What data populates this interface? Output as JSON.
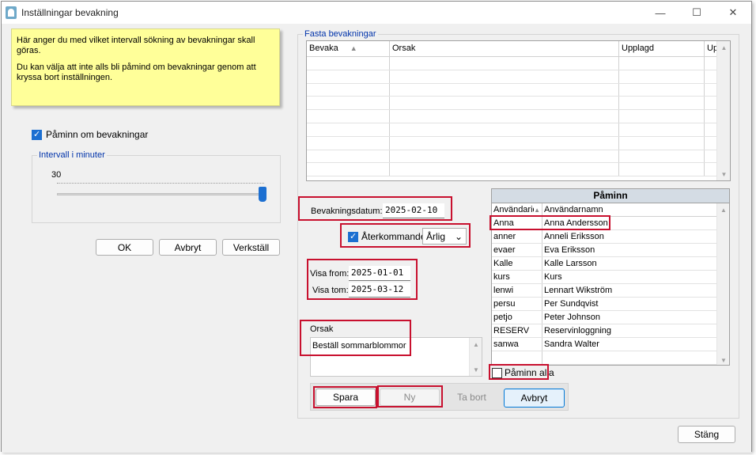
{
  "window": {
    "title": "Inställningar bevakning"
  },
  "title_controls": {
    "minimize": "—",
    "maximize": "☐",
    "close": "✕"
  },
  "note": {
    "line1": "Här anger du med vilket intervall sökning av bevakningar skall göras.",
    "line2": "Du kan välja att inte alls bli påmind om bevakningar genom att kryssa bort inställningen."
  },
  "remind": {
    "label": "Påminn om bevakningar",
    "checked": true
  },
  "interval": {
    "legend": "Intervall i minuter",
    "value": "30",
    "slider_fraction": 1.0
  },
  "left_buttons": {
    "ok": "OK",
    "cancel": "Avbryt",
    "apply": "Verkställ"
  },
  "fasta": {
    "legend": "Fasta bevakningar",
    "columns": [
      "Bevaka",
      "Orsak",
      "Upplagd",
      "Up"
    ],
    "sort_indicator": "▲"
  },
  "form": {
    "date_label": "Bevakningsdatum:",
    "date_value": "2025-02-10",
    "recurring_label": "Återkommande",
    "recurring_checked": true,
    "recurring_value": "Årlig",
    "from_label": "Visa from:",
    "from_value": "2025-01-01",
    "tom_label": "Visa tom:",
    "tom_value": "2025-03-12",
    "reason_label": "Orsak",
    "reason_value": "Beställ sommarblommor"
  },
  "action_buttons": {
    "save": "Spara",
    "new": "Ny",
    "delete": "Ta bort",
    "cancel": "Avbryt"
  },
  "paminn": {
    "title": "Påminn",
    "columns": [
      "Användarid",
      "Användarnamn"
    ],
    "rows": [
      {
        "id": "Anna",
        "name": "Anna Andersson"
      },
      {
        "id": "anner",
        "name": "Anneli Eriksson"
      },
      {
        "id": "evaer",
        "name": "Eva Eriksson"
      },
      {
        "id": "Kalle",
        "name": "Kalle Larsson"
      },
      {
        "id": "kurs",
        "name": "Kurs"
      },
      {
        "id": "lenwi",
        "name": "Lennart Wikström"
      },
      {
        "id": "persu",
        "name": "Per Sundqvist"
      },
      {
        "id": "petjo",
        "name": "Peter Johnson"
      },
      {
        "id": "RESERV",
        "name": "Reservinloggning"
      },
      {
        "id": "sanwa",
        "name": "Sandra Walter"
      }
    ],
    "all_label": "Påminn alla",
    "all_checked": false
  },
  "close_button": "Stäng",
  "colors": {
    "highlight": "#c8102e",
    "note_bg": "#ffff99",
    "accent": "#1c6fd1"
  }
}
